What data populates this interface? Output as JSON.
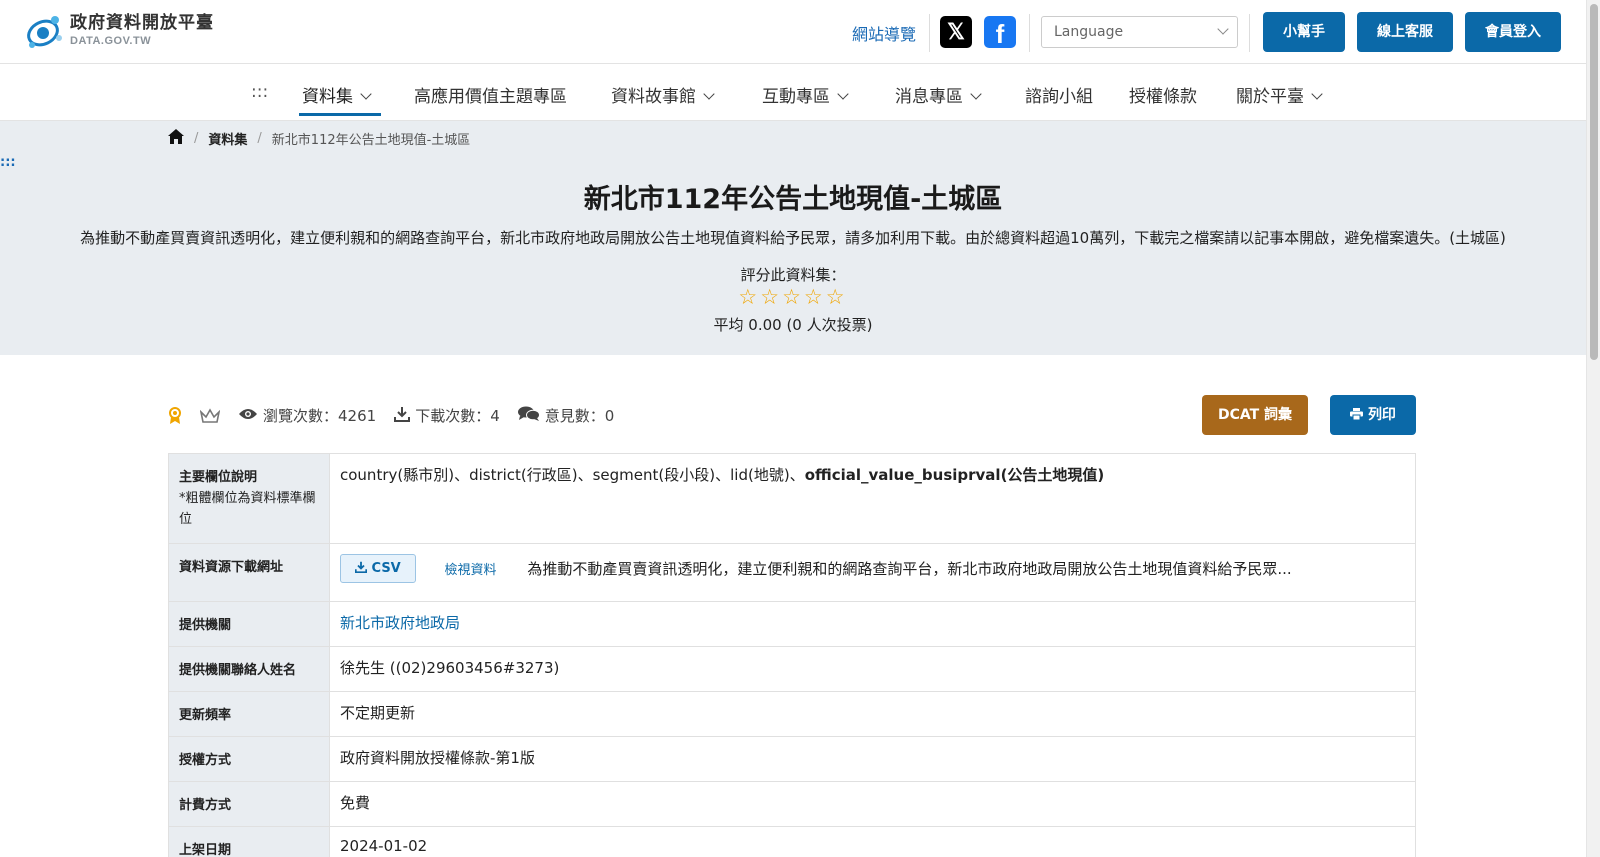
{
  "header": {
    "logo_title": "政府資料開放平臺",
    "logo_subtitle": "DATA.GOV.TW",
    "sitemap": "網站導覽",
    "x_icon_text": "𝕏",
    "fb_icon_text": "f",
    "language_placeholder": "Language",
    "buttons": {
      "helper": "小幫手",
      "support": "線上客服",
      "login": "會員登入"
    },
    "brand_color": "#0b69a8"
  },
  "nav": {
    "skip": ":::",
    "items": [
      "資料集",
      "高應用價值主題專區",
      "資料故事館",
      "互動專區",
      "消息專區",
      "諮詢小組",
      "授權條款",
      "關於平臺"
    ],
    "active_index": 0
  },
  "breadcrumb": {
    "items": [
      "資料集",
      "新北市112年公告土地現值-土城區"
    ]
  },
  "skip_marker": ":::",
  "dataset": {
    "title": "新北市112年公告土地現值-土城區",
    "description": "為推動不動產買賣資訊透明化，建立便利親和的網路查詢平台，新北市政府地政局開放公告土地現值資料給予民眾，請多加利用下載。由於總資料超過10萬列，下載完之檔案請以記事本開啟，避免檔案遺失。(土城區)",
    "rating_label": "評分此資料集：",
    "stars": "☆☆☆☆☆",
    "rating_average": "平均 0.00 (0 人次投票)",
    "rating_value": 0,
    "rating_max": 5
  },
  "stats": {
    "views_label": "瀏覽次數：",
    "views": "4261",
    "downloads_label": "下載次數：",
    "downloads": "4",
    "comments_label": "意見數：",
    "comments": "0",
    "dcat_label": "DCAT 詞彙",
    "print_label": "列印",
    "dcat_color": "#a8681b"
  },
  "table": {
    "rows": {
      "fields": {
        "key": "主要欄位說明",
        "note": "*粗體欄位為資料標準欄位",
        "value_plain": "country(縣市別)、district(行政區)、segment(段小段)、lid(地號)、",
        "value_bold": "official_value_busiprval(公告土地現值)"
      },
      "resource": {
        "key": "資料資源下載網址",
        "format": "CSV",
        "view": "檢視資料",
        "desc": "為推動不動產買賣資訊透明化，建立便利親和的網路查詢平台，新北市政府地政局開放公告土地現值資料給予民眾..."
      },
      "provider": {
        "key": "提供機關",
        "value": "新北市政府地政局"
      },
      "contact": {
        "key": "提供機關聯絡人姓名",
        "value": "徐先生 ((02)29603456#3273)"
      },
      "frequency": {
        "key": "更新頻率",
        "value": "不定期更新"
      },
      "license": {
        "key": "授權方式",
        "value": "政府資料開放授權條款-第1版"
      },
      "fee": {
        "key": "計費方式",
        "value": "免費"
      },
      "published": {
        "key": "上架日期",
        "value": "2024-01-02"
      }
    }
  }
}
